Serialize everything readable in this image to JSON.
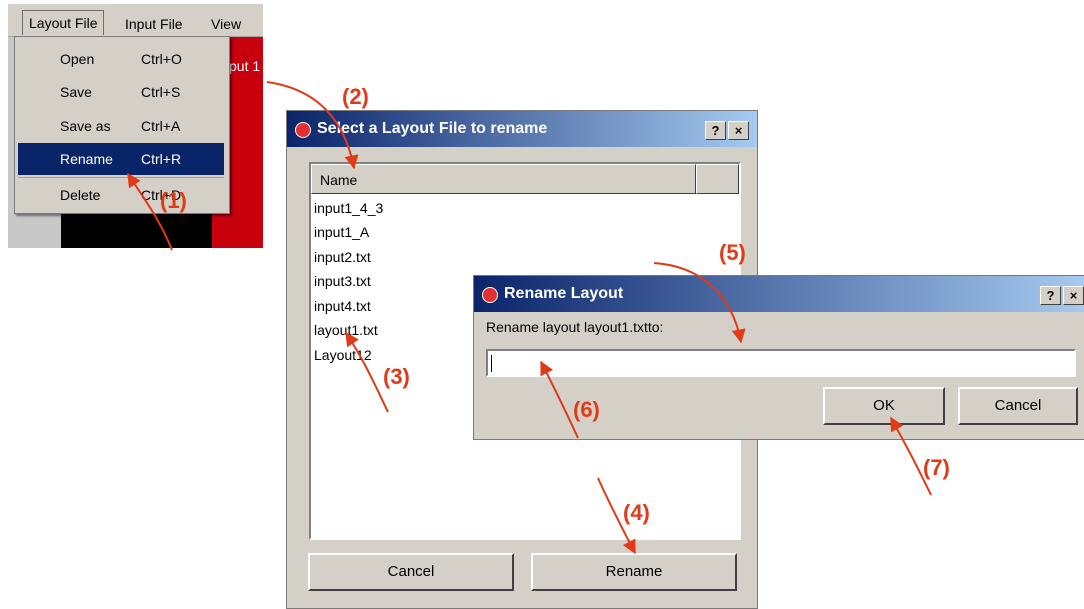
{
  "menubar": {
    "items": [
      "Layout File",
      "Input File",
      "View"
    ]
  },
  "background_window": {
    "partial_text": "put 1"
  },
  "menu": {
    "items": [
      {
        "label": "Open",
        "shortcut": "Ctrl+O"
      },
      {
        "label": "Save",
        "shortcut": "Ctrl+S"
      },
      {
        "label": "Save as",
        "shortcut": "Ctrl+A"
      },
      {
        "label": "Rename",
        "shortcut": "Ctrl+R",
        "selected": true
      },
      {
        "label": "Delete",
        "shortcut": "Ctrl+D"
      }
    ]
  },
  "select_dialog": {
    "title": "Select a Layout File to rename",
    "help_button": "?",
    "close_button": "×",
    "column_header": "Name",
    "files": [
      "input1_4_3",
      "input1_A",
      "input2.txt",
      "input3.txt",
      "input4.txt",
      "layout1.txt",
      "Layout12"
    ],
    "cancel_label": "Cancel",
    "rename_label": "Rename"
  },
  "rename_dialog": {
    "title": "Rename Layout",
    "help_button": "?",
    "close_button": "×",
    "prompt": "Rename layout layout1.txtto:",
    "input_value": "",
    "ok_label": "OK",
    "cancel_label": "Cancel"
  },
  "annotations": {
    "color": "#e03a17",
    "steps": [
      "(1)",
      "(2)",
      "(3)",
      "(4)",
      "(5)",
      "(6)",
      "(7)"
    ]
  }
}
